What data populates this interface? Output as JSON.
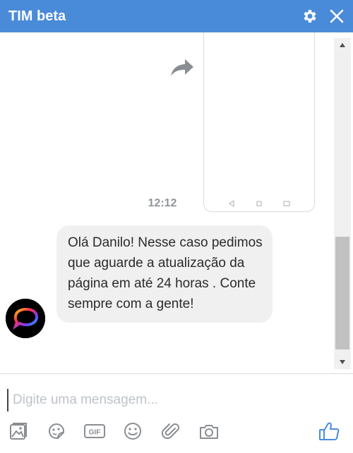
{
  "header": {
    "title": "TIM beta",
    "settings_icon": "gear-icon",
    "close_icon": "close-icon",
    "background": "#4a8bd9"
  },
  "chat": {
    "timestamp": "12:12",
    "message": {
      "sender": "TIM",
      "text": "Olá Danilo! Nesse caso pedimos que aguarde a atualização da página em até 24 horas . Conte sempre com a gente!"
    }
  },
  "composer": {
    "placeholder": "Digite uma mensagem...",
    "value": ""
  },
  "toolbar": {
    "icons": [
      "photo-icon",
      "sticker-icon",
      "gif-icon",
      "emoji-icon",
      "attachment-icon",
      "camera-icon",
      "like-icon"
    ],
    "gif_label": "GIF",
    "accent": "#4a8bd9"
  }
}
